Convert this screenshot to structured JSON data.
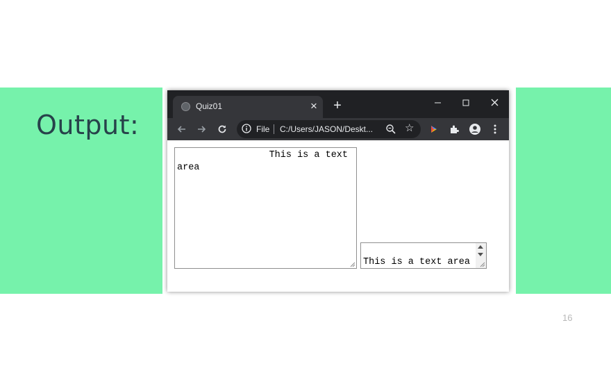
{
  "slide": {
    "heading": "Output:",
    "page_number": "16",
    "accent_color": "#76f2ab",
    "heading_color": "#27424a"
  },
  "browser": {
    "tab": {
      "title": "Quiz01",
      "favicon": "globe-icon",
      "close_icon": "close-icon"
    },
    "new_tab_icon": "plus-icon",
    "window_controls": [
      "minimize-icon",
      "maximize-icon",
      "close-icon"
    ],
    "toolbar": {
      "back_icon": "back-arrow-icon",
      "forward_icon": "forward-arrow-icon",
      "reload_icon": "reload-icon",
      "address": {
        "scheme_label": "File",
        "url": "C:/Users/JASON/Deskt...",
        "info_icon": "info-icon",
        "zoom_icon": "zoom-icon",
        "bookmark_icon": "star-icon"
      },
      "extension_icons": [
        "extension-logo-icon",
        "puzzle-icon",
        "profile-icon",
        "more-vert-icon"
      ]
    },
    "theme": {
      "titlebar": "#202124",
      "toolbar": "#35363a",
      "text": "#e8eaed"
    }
  },
  "content": {
    "textarea_large": {
      "line1": "This is a text",
      "line2": "area"
    },
    "textarea_small": {
      "value": "This is a text area"
    }
  }
}
